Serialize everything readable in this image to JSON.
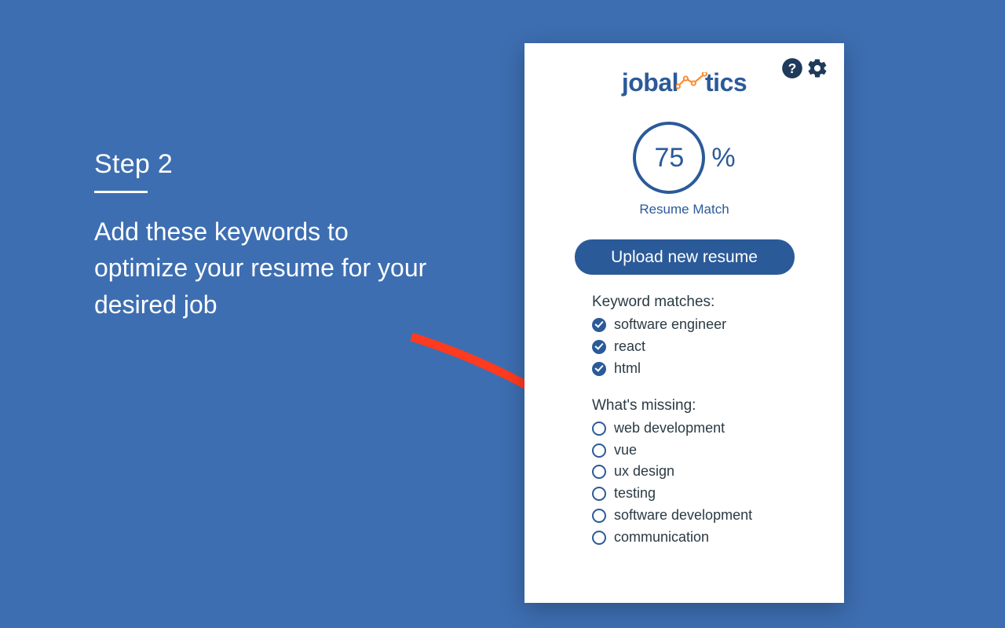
{
  "left": {
    "step_label": "Step 2",
    "headline": "Add these keywords to optimize your resume for your desired job"
  },
  "brand": {
    "part1": "jobal",
    "part2": "tics"
  },
  "score": {
    "value": "75",
    "unit": "%",
    "label": "Resume Match"
  },
  "buttons": {
    "upload": "Upload new resume"
  },
  "matches": {
    "title": "Keyword matches:",
    "items": [
      "software engineer",
      "react",
      "html"
    ]
  },
  "missing": {
    "title": "What's missing:",
    "items": [
      "web development",
      "vue",
      "ux design",
      "testing",
      "software development",
      "communication"
    ]
  },
  "colors": {
    "bg": "#3d6eb1",
    "brand_blue": "#2b5a99",
    "arrow": "#ff3b1f"
  }
}
